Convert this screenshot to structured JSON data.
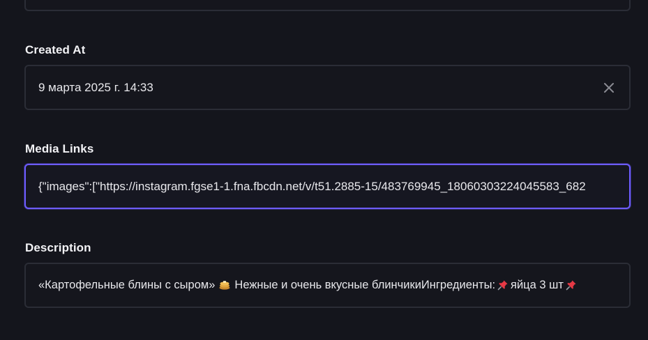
{
  "created_at": {
    "label": "Created At",
    "value": "9 марта 2025 г. 14:33"
  },
  "media_links": {
    "label": "Media Links",
    "value": "{\"images\":[\"https://instagram.fgse1-1.fna.fbcdn.net/v/t51.2885-15/483769945_18060303224045583_682"
  },
  "description": {
    "label": "Description",
    "part1": "«Картофельные блины с сыром»",
    "part2": "Нежные и очень вкусные блинчикиИнгредиенты:",
    "part3": "яйца 3 шт"
  },
  "icons": {
    "clear": "close-icon",
    "pancake": "pancakes-emoji",
    "pin": "pushpin-emoji"
  },
  "colors": {
    "background": "#14151c",
    "field_border": "#2b2d36",
    "focus_border": "#6d5cff"
  }
}
